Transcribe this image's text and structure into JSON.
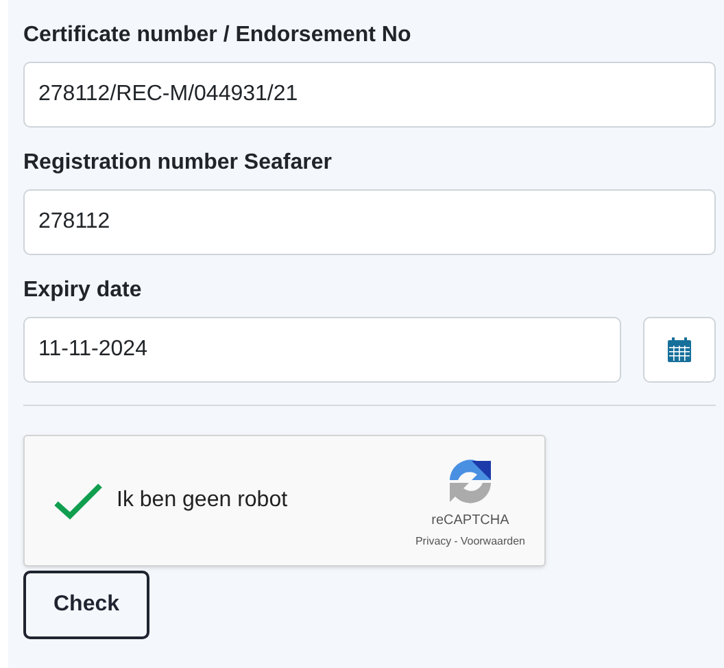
{
  "fields": [
    {
      "label": "Certificate number / Endorsement No",
      "value": "278112/REC-M/044931/21",
      "kind": "text"
    },
    {
      "label": "Registration number Seafarer",
      "value": "278112",
      "kind": "text"
    },
    {
      "label": "Expiry date",
      "value": "11-11-2024",
      "kind": "date"
    }
  ],
  "captcha": {
    "label": "Ik ben geen robot",
    "checked": true,
    "brand": "reCAPTCHA",
    "privacy": "Privacy",
    "separator": "-",
    "terms": "Voorwaarden"
  },
  "button": "Check"
}
